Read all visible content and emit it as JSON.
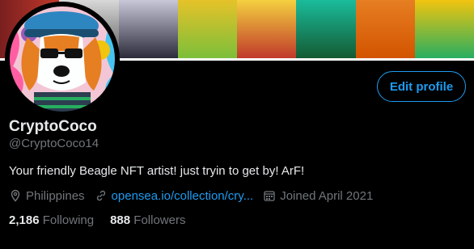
{
  "profile": {
    "display_name": "CryptoCoco",
    "handle": "@CryptoCoco14",
    "bio": "Your friendly Beagle NFT artist! just tryin to get by! ArF!",
    "location": "Philippines",
    "website": "opensea.io/collection/cry...",
    "joined": "Joined April 2021",
    "following_count": "2,186",
    "following_label": "Following",
    "followers_count": "888",
    "followers_label": "Followers"
  },
  "actions": {
    "edit_profile_label": "Edit profile"
  },
  "colors": {
    "accent": "#1d9bf0",
    "background": "#000000",
    "primary_text": "#e7e9ea",
    "secondary_text": "#71767b"
  },
  "icons": {
    "location": "location-pin-icon",
    "website": "link-icon",
    "joined": "calendar-icon"
  }
}
